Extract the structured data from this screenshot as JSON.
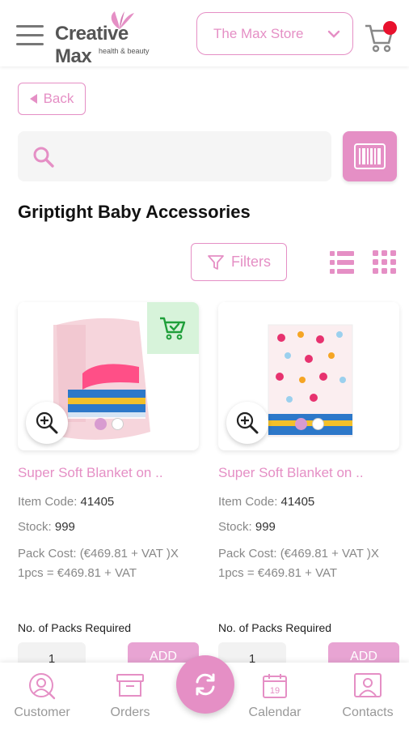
{
  "header": {
    "logo_text": "Creative Max",
    "logo_tagline": "health & beauty",
    "store_name": "The Max Store",
    "cart_has_badge": true
  },
  "back_label": "Back",
  "search": {
    "placeholder": "",
    "value": ""
  },
  "page_title": "Griptight Baby Accessories",
  "filters_label": "Filters",
  "products": [
    {
      "name": "Super Soft Blanket on ..",
      "item_code_label": "Item Code:",
      "item_code": "41405",
      "stock_label": "Stock:",
      "stock": "999",
      "pack_cost_line1": "Pack Cost: (€469.81 + VAT )X",
      "pack_cost_line2": "1pcs = €469.81 + VAT",
      "packs_required_label": "No. of Packs Required",
      "qty_value": "1",
      "add_label": "ADD",
      "in_cart": true,
      "image_color": "#f6d5dc"
    },
    {
      "name": "Super Soft Blanket on ..",
      "item_code_label": "Item Code:",
      "item_code": "41405",
      "stock_label": "Stock:",
      "stock": "999",
      "pack_cost_line1": "Pack Cost: (€469.81 + VAT )X",
      "pack_cost_line2": "1pcs = €469.81 + VAT",
      "packs_required_label": "No. of Packs Required",
      "qty_value": "1",
      "add_label": "ADD",
      "in_cart": false,
      "image_color": "#fbeef0"
    }
  ],
  "tabbar": {
    "customer": "Customer",
    "orders": "Orders",
    "calendar": "Calendar",
    "calendar_day": "19",
    "contacts": "Contacts"
  },
  "colors": {
    "accent": "#e58fc5",
    "cart_badge": "#e8112d",
    "added_badge": "#d7f3da"
  }
}
